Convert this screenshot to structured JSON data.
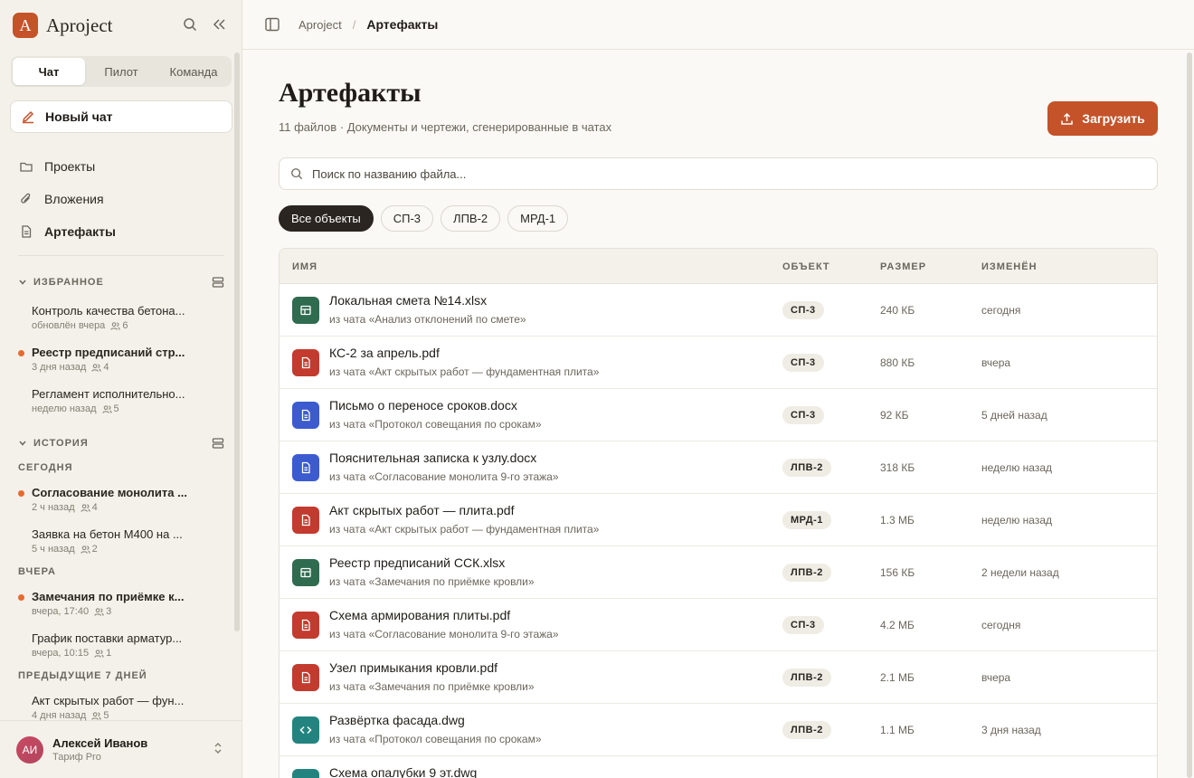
{
  "brand": {
    "logo_letter": "A",
    "name": "Aproject"
  },
  "sidebar": {
    "tabs": [
      {
        "label": "Чат",
        "active": true
      },
      {
        "label": "Пилот",
        "active": false
      },
      {
        "label": "Команда",
        "active": false
      }
    ],
    "new_chat": "Новый чат",
    "nav": [
      {
        "label": "Проекты",
        "icon": "folder-icon",
        "active": false
      },
      {
        "label": "Вложения",
        "icon": "paperclip-icon",
        "active": false
      },
      {
        "label": "Артефакты",
        "icon": "document-icon",
        "active": true
      }
    ],
    "favorites": {
      "title": "ИЗБРАННОЕ",
      "items": [
        {
          "title": "Контроль качества бетона...",
          "meta": "обновлён вчера",
          "count": "6",
          "unread": false,
          "bold": false
        },
        {
          "title": "Реестр предписаний стр...",
          "meta": "3 дня назад",
          "count": "4",
          "unread": true,
          "bold": true
        },
        {
          "title": "Регламент исполнительно...",
          "meta": "неделю назад",
          "count": "5",
          "unread": false,
          "bold": false
        }
      ]
    },
    "history": {
      "title": "ИСТОРИЯ",
      "groups": [
        {
          "label": "СЕГОДНЯ",
          "items": [
            {
              "title": "Согласование монолита ...",
              "meta": "2 ч назад",
              "count": "4",
              "unread": true,
              "bold": true
            },
            {
              "title": "Заявка на бетон М400 на ...",
              "meta": "5 ч назад",
              "count": "2",
              "unread": false,
              "bold": false
            }
          ]
        },
        {
          "label": "ВЧЕРА",
          "items": [
            {
              "title": "Замечания по приёмке к...",
              "meta": "вчера, 17:40",
              "count": "3",
              "unread": true,
              "bold": true
            },
            {
              "title": "График поставки арматур...",
              "meta": "вчера, 10:15",
              "count": "1",
              "unread": false,
              "bold": false
            }
          ]
        },
        {
          "label": "ПРЕДЫДУЩИЕ 7 ДНЕЙ",
          "items": [
            {
              "title": "Акт скрытых работ — фун...",
              "meta": "4 дня назад",
              "count": "5",
              "unread": false,
              "bold": false
            }
          ]
        }
      ]
    },
    "user": {
      "initials": "АИ",
      "name": "Алексей Иванов",
      "plan": "Тариф Pro"
    }
  },
  "topbar": {
    "crumbs": [
      "Aproject",
      "Артефакты"
    ]
  },
  "main": {
    "title": "Артефакты",
    "subtitle": "11 файлов · Документы и чертежи, сгенерированные в чатах",
    "upload_label": "Загрузить",
    "search_placeholder": "Поиск по названию файла...",
    "filters": [
      {
        "label": "Все объекты",
        "active": true
      },
      {
        "label": "СП-3",
        "active": false
      },
      {
        "label": "ЛПВ-2",
        "active": false
      },
      {
        "label": "МРД-1",
        "active": false
      }
    ],
    "columns": [
      "ИМЯ",
      "ОБЪЕКТ",
      "РАЗМЕР",
      "ИЗМЕНЁН"
    ],
    "rows": [
      {
        "name": "Локальная смета №14.xlsx",
        "source": "из чата «Анализ отклонений по смете»",
        "object": "СП-3",
        "size": "240 КБ",
        "modified": "сегодня",
        "type": "sheet"
      },
      {
        "name": "КС-2 за апрель.pdf",
        "source": "из чата «Акт скрытых работ — фундаментная плита»",
        "object": "СП-3",
        "size": "880 КБ",
        "modified": "вчера",
        "type": "pdf"
      },
      {
        "name": "Письмо о переносе сроков.docx",
        "source": "из чата «Протокол совещания по срокам»",
        "object": "СП-3",
        "size": "92 КБ",
        "modified": "5 дней назад",
        "type": "doc"
      },
      {
        "name": "Пояснительная записка к узлу.docx",
        "source": "из чата «Согласование монолита 9-го этажа»",
        "object": "ЛПВ-2",
        "size": "318 КБ",
        "modified": "неделю назад",
        "type": "doc"
      },
      {
        "name": "Акт скрытых работ — плита.pdf",
        "source": "из чата «Акт скрытых работ — фундаментная плита»",
        "object": "МРД-1",
        "size": "1.3 МБ",
        "modified": "неделю назад",
        "type": "pdf"
      },
      {
        "name": "Реестр предписаний ССК.xlsx",
        "source": "из чата «Замечания по приёмке кровли»",
        "object": "ЛПВ-2",
        "size": "156 КБ",
        "modified": "2 недели назад",
        "type": "sheet"
      },
      {
        "name": "Схема армирования плиты.pdf",
        "source": "из чата «Согласование монолита 9-го этажа»",
        "object": "СП-3",
        "size": "4.2 МБ",
        "modified": "сегодня",
        "type": "pdf"
      },
      {
        "name": "Узел примыкания кровли.pdf",
        "source": "из чата «Замечания по приёмке кровли»",
        "object": "ЛПВ-2",
        "size": "2.1 МБ",
        "modified": "вчера",
        "type": "pdf"
      },
      {
        "name": "Развёртка фасада.dwg",
        "source": "из чата «Протокол совещания по срокам»",
        "object": "ЛПВ-2",
        "size": "1.1 МБ",
        "modified": "3 дня назад",
        "type": "cad"
      },
      {
        "name": "Схема опалубки 9 эт.dwg",
        "source": "",
        "object": "",
        "size": "",
        "modified": "",
        "type": "cad"
      }
    ]
  },
  "colors": {
    "accent": "#c4532a",
    "sheet": "#2f6b4f",
    "pdf": "#c23b2e",
    "doc": "#3b5bcf",
    "cad": "#23847f",
    "unread": "#e86a2c"
  }
}
